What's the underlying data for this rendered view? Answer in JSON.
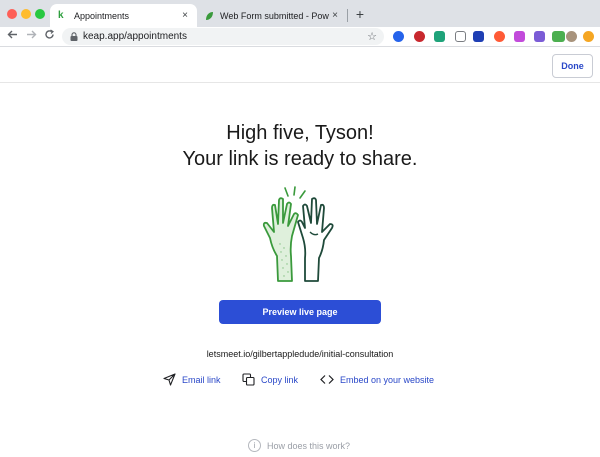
{
  "browser": {
    "tabs": [
      {
        "title": "Appointments",
        "active": true
      },
      {
        "title": "Web Form submitted - Powere",
        "active": false
      }
    ],
    "close_glyph": "×",
    "new_tab_glyph": "+",
    "url": "keap.app/appointments",
    "extensions": [
      "blue-circle-ext",
      "red-ublock-ext",
      "green-c-ext",
      "camera-ext",
      "blue-off-ext",
      "red-target-ext",
      "pink-ext",
      "purple-ext",
      "green-bu-ext",
      "avatar-ext",
      "orange-ext"
    ]
  },
  "header": {
    "done_label": "Done"
  },
  "main": {
    "headline_line1": "High five, Tyson!",
    "headline_line2": "Your link is ready to share.",
    "preview_label": "Preview live page",
    "share_link": "letsmeet.io/gilbertappledude/initial-consultation",
    "actions": {
      "email": "Email link",
      "copy": "Copy link",
      "embed": "Embed on your website"
    },
    "help_text": "How does this work?",
    "help_icon_glyph": "i"
  },
  "colors": {
    "primary": "#2c4ed6",
    "link": "#2a48c8",
    "hand_green": "#3a9a3c",
    "hand_dark": "#1f4a3a"
  }
}
